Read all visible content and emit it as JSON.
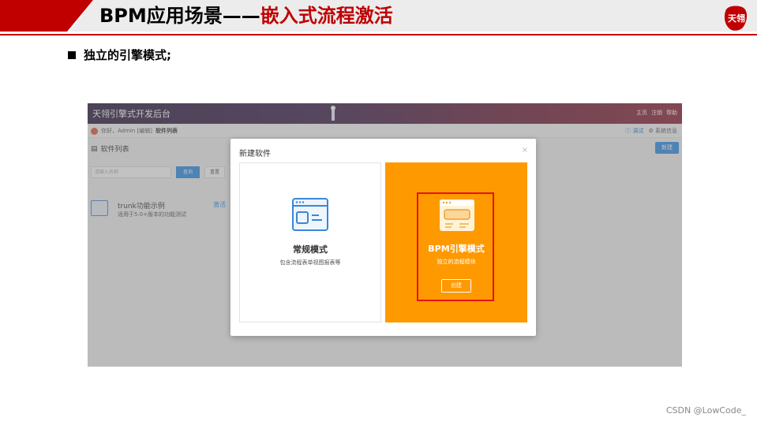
{
  "title": {
    "prefix": "BPM应用场景——",
    "highlight": "嵌入式流程激活"
  },
  "logo_text": "天翎",
  "bullet": "独立的引擎模式;",
  "screenshot": {
    "app_title": "天翎引擎式开发后台",
    "header_links": [
      "主页",
      "注销",
      "帮助"
    ],
    "greeting": "你好，Admin [编辑]",
    "breadcrumb": "软件列表",
    "right_links": {
      "debug": "调试",
      "sysinfo": "系统信息"
    },
    "section_title": "软件列表",
    "new_button": "新建",
    "search_placeholder": "请输入名称",
    "query_button": "查询",
    "reset_button": "重置",
    "card": {
      "name": "trunk功能示例",
      "desc": "适用于5.0+版本的功能测试",
      "action": "激活"
    }
  },
  "modal": {
    "title": "新建软件",
    "close": "×",
    "options": [
      {
        "name": "常规模式",
        "desc": "包含流程表单视图报表等"
      },
      {
        "name": "BPM引擎模式",
        "desc": "独立的流程模块",
        "button": "创建"
      }
    ]
  },
  "credit": "CSDN @LowCode_",
  "colors": {
    "accent_red": "#c00000",
    "orange": "#ff9900",
    "blue": "#2d8ce8"
  }
}
